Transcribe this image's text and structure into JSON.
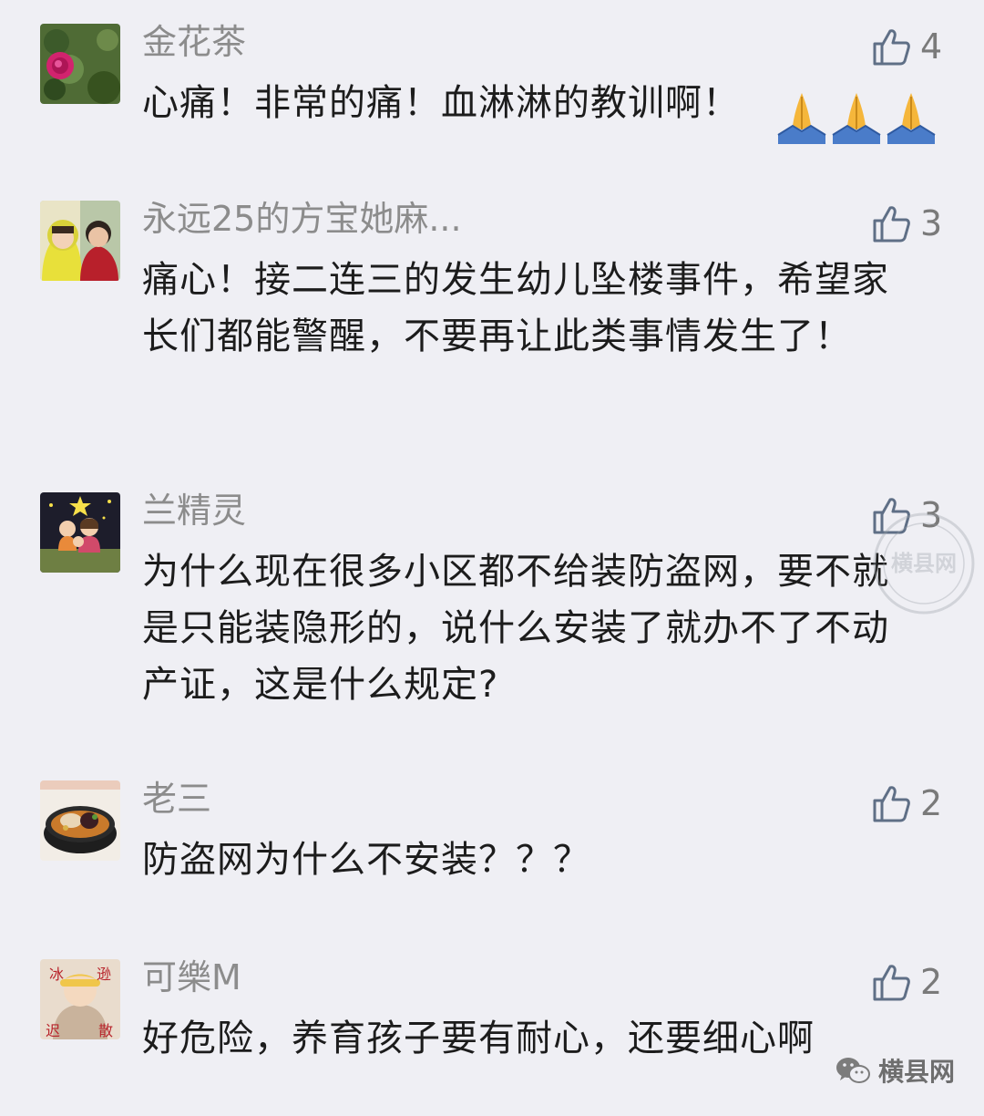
{
  "comments": [
    {
      "nickname": "金花茶",
      "text": "心痛！非常的痛！血淋淋的教训啊！",
      "likes": "4",
      "avatar": "rose-flower-avatar"
    },
    {
      "nickname": "永远25的方宝她麻...",
      "text": "痛心！接二连三的发生幼儿坠楼事件，希望家长们都能警醒，不要再让此类事情发生了！",
      "likes": "3",
      "avatar": "two-people-photo-avatar"
    },
    {
      "nickname": "兰精灵",
      "text": "为什么现在很多小区都不给装防盗网，要不就是只能装隐形的，说什么安装了就办不了不动产证，这是什么规定?",
      "likes": "3",
      "avatar": "cartoon-family-avatar"
    },
    {
      "nickname": "老三",
      "text": "防盗网为什么不安装？？？",
      "likes": "2",
      "avatar": "food-bowl-avatar"
    },
    {
      "nickname": "可樂M",
      "text": "好危险，养育孩子要有耐心，还要细心啊",
      "likes": "2",
      "avatar": "child-photo-avatar",
      "avatar_chars": [
        "冰",
        "逊",
        "迟",
        "散"
      ]
    }
  ],
  "brand": {
    "name": "横县网",
    "icon": "wechat-icon"
  },
  "watermark": {
    "text": "横县网"
  },
  "colors": {
    "background": "#efeff4",
    "nickname": "#8c8c8c",
    "text": "#1c1c1c",
    "like_icon": "#5f6f86"
  }
}
